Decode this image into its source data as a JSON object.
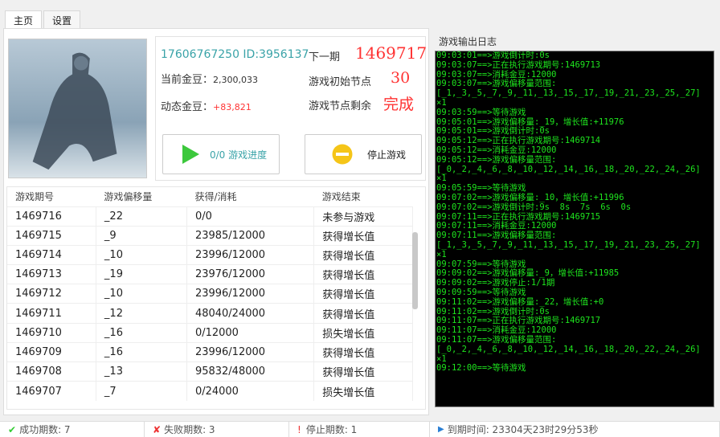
{
  "tabs": [
    "主页",
    "设置"
  ],
  "account": {
    "phone_id": "17606767250 ID:3956137",
    "current_label": "当前金豆：",
    "current_value": "2,300,033",
    "dynamic_label": "动态金豆：",
    "dynamic_value": "+83,821"
  },
  "game": {
    "next_label": "下一期",
    "next_value": "1469717",
    "init_label": "游戏初始节点",
    "init_value": "30",
    "remain_label": "游戏节点剩余",
    "remain_value": "完成"
  },
  "buttons": {
    "progress": "0/0 游戏进度",
    "stop": "停止游戏"
  },
  "colors": {
    "accent": "#3aa3a8",
    "red": "#ff3333",
    "log_text": "#1ee51e",
    "play": "#3cc83c",
    "stop": "#f5c518"
  },
  "table": {
    "headers": [
      "游戏期号",
      "游戏偏移量",
      "获得/消耗",
      "游戏结束"
    ],
    "rows": [
      [
        "1469716",
        "_22",
        "0/0",
        "未参与游戏"
      ],
      [
        "1469715",
        "_9",
        "23985/12000",
        "获得增长值"
      ],
      [
        "1469714",
        "_10",
        "23996/12000",
        "获得增长值"
      ],
      [
        "1469713",
        "_19",
        "23976/12000",
        "获得增长值"
      ],
      [
        "1469712",
        "_10",
        "23996/12000",
        "获得增长值"
      ],
      [
        "1469711",
        "_12",
        "48040/24000",
        "获得增长值"
      ],
      [
        "1469710",
        "_16",
        "0/12000",
        "损失增长值"
      ],
      [
        "1469709",
        "_16",
        "23996/12000",
        "获得增长值"
      ],
      [
        "1469708",
        "_13",
        "95832/48000",
        "获得增长值"
      ],
      [
        "1469707",
        "_7",
        "0/24000",
        "损失增长值"
      ]
    ]
  },
  "log": {
    "title": "游戏输出日志",
    "lines": [
      "09:03:01==>游戏倒计时:0s",
      "09:03:07==>正在执行游戏期号:1469713",
      "09:03:07==>消耗金豆:12000",
      "09:03:07==>游戏偏移量范围:",
      "[_1,_3,_5,_7,_9,_11,_13,_15,_17,_19,_21,_23,_25,_27]",
      "×1",
      "09:03:59==>等待游戏",
      "09:05:01==>游戏偏移量:_19，增长值:+11976",
      "09:05:01==>游戏倒计时:0s",
      "09:05:12==>正在执行游戏期号:1469714",
      "09:05:12==>消耗金豆:12000",
      "09:05:12==>游戏偏移量范围:",
      "[_0,_2,_4,_6,_8,_10,_12,_14,_16,_18,_20,_22,_24,_26]",
      "×1",
      "09:05:59==>等待游戏",
      "09:07:02==>游戏偏移量:_10，增长值:+11996",
      "09:07:02==>游戏倒计时:9s  8s  7s  6s  0s",
      "09:07:11==>正在执行游戏期号:1469715",
      "09:07:11==>消耗金豆:12000",
      "09:07:11==>游戏偏移量范围:",
      "[_1,_3,_5,_7,_9,_11,_13,_15,_17,_19,_21,_23,_25,_27]",
      "×1",
      "09:07:59==>等待游戏",
      "09:09:02==>游戏偏移量:_9，增长值:+11985",
      "09:09:02==>游戏停止:1/1期",
      "09:09:59==>等待游戏",
      "09:11:02==>游戏偏移量:_22，增长值:+0",
      "09:11:02==>游戏倒计时:0s",
      "09:11:07==>正在执行游戏期号:1469717",
      "09:11:07==>消耗金豆:12000",
      "09:11:07==>游戏偏移量范围:",
      "[_0,_2,_4,_6,_8,_10,_12,_14,_16,_18,_20,_22,_24,_26]",
      "×1",
      "09:12:00==>等待游戏"
    ]
  },
  "status": {
    "success": "成功期数: 7",
    "fail": "失败期数: 3",
    "stop": "停止期数: 1",
    "expire": "到期时间: 23304天23时29分53秒"
  }
}
